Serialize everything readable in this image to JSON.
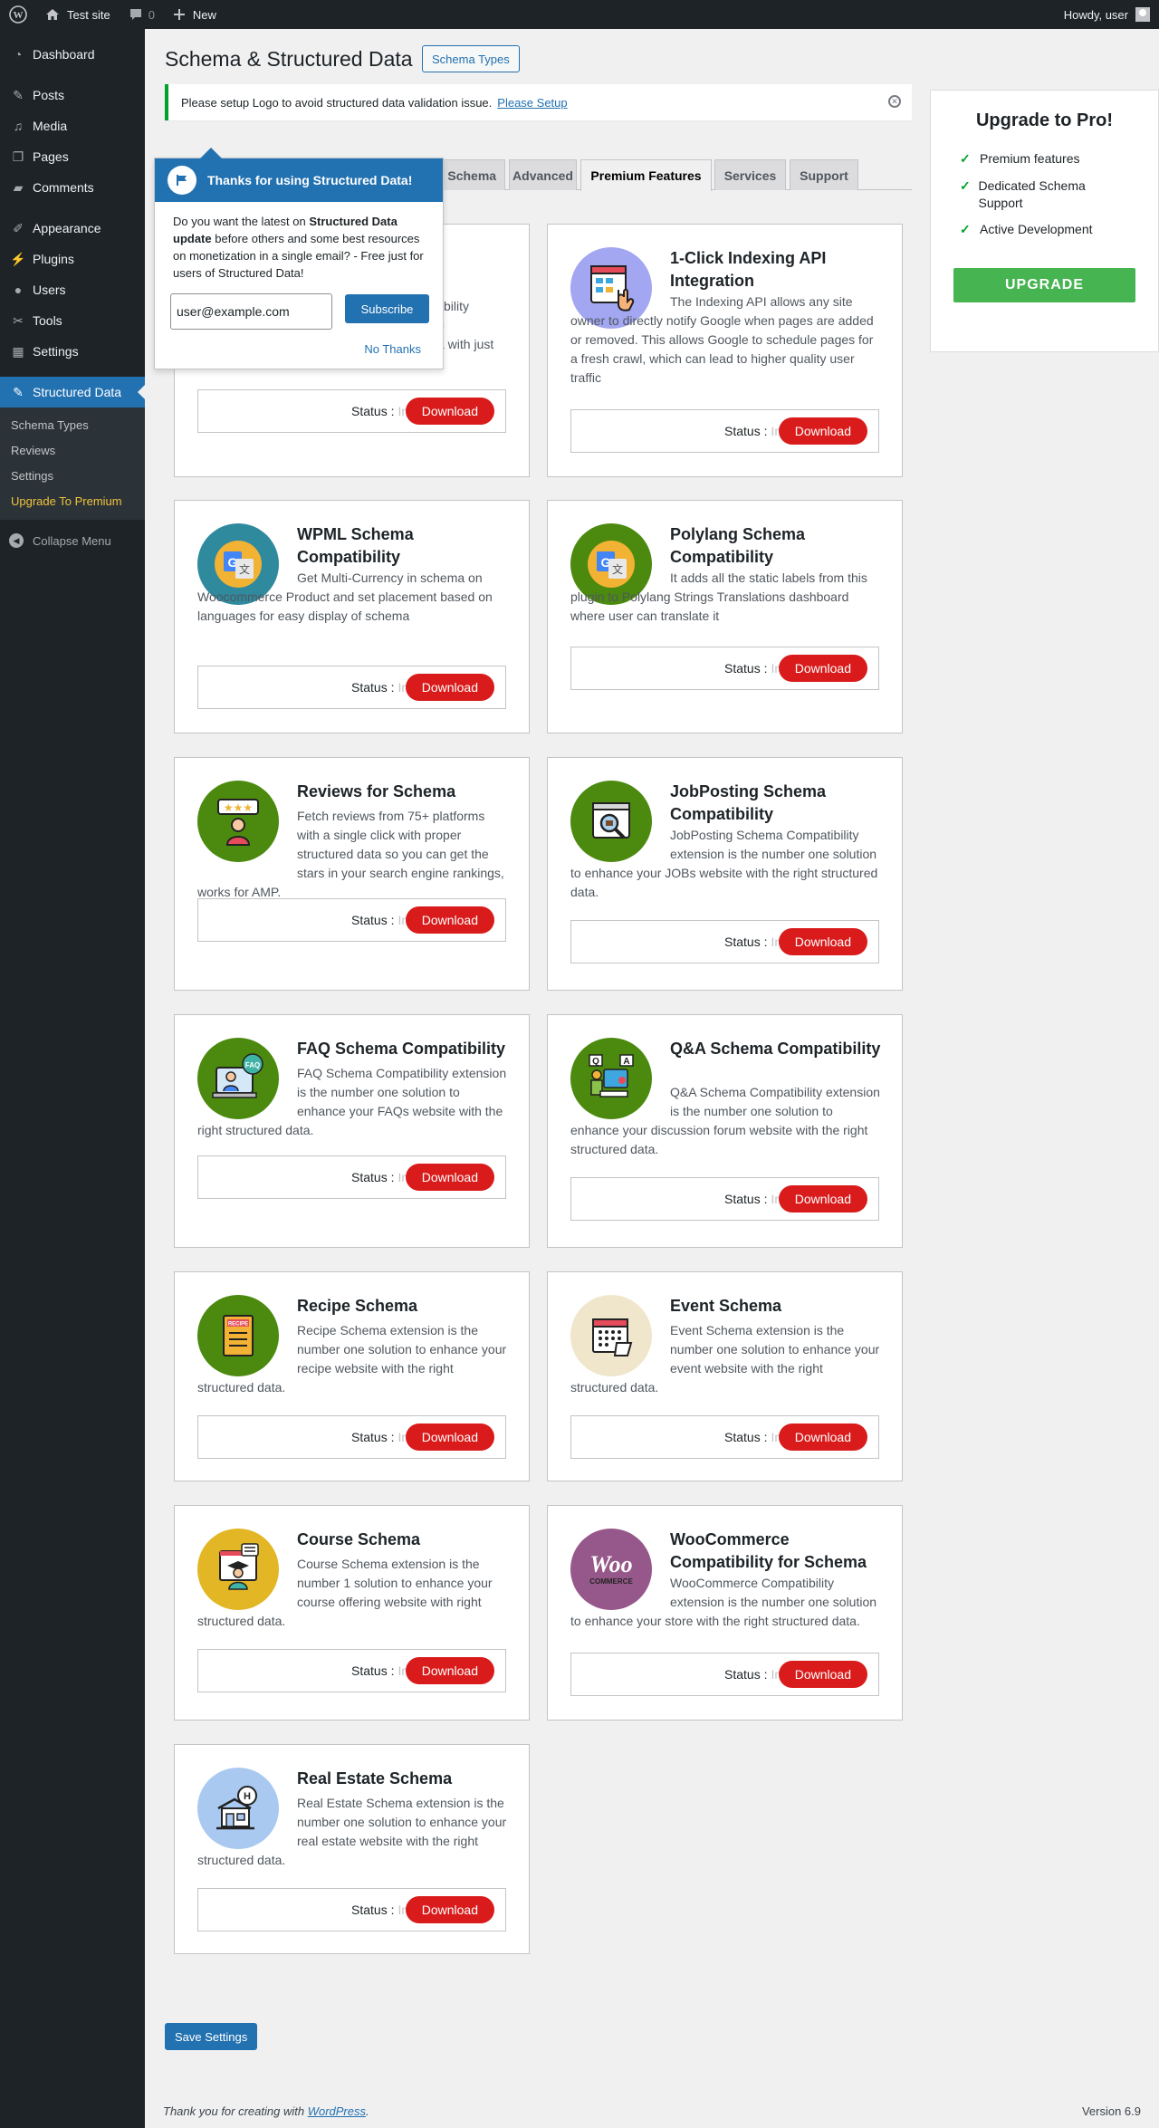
{
  "adminbar": {
    "site_name": "Test site",
    "comments_count": "0",
    "new_label": "New",
    "howdy": "Howdy, user"
  },
  "sidebar": {
    "items": [
      {
        "label": "Dashboard",
        "icon": "dashboard-icon"
      },
      {
        "label": "Posts",
        "icon": "pin-icon"
      },
      {
        "label": "Media",
        "icon": "media-icon"
      },
      {
        "label": "Pages",
        "icon": "pages-icon"
      },
      {
        "label": "Comments",
        "icon": "comment-icon"
      },
      {
        "label": "Appearance",
        "icon": "brush-icon"
      },
      {
        "label": "Plugins",
        "icon": "plug-icon"
      },
      {
        "label": "Users",
        "icon": "user-icon"
      },
      {
        "label": "Tools",
        "icon": "wrench-icon"
      },
      {
        "label": "Settings",
        "icon": "settings-icon"
      },
      {
        "label": "Structured Data",
        "icon": "pin-icon"
      }
    ],
    "submenu": [
      "Schema Types",
      "Reviews",
      "Settings",
      "Upgrade To Premium"
    ],
    "collapse": "Collapse Menu"
  },
  "header": {
    "title": "Schema & Structured Data",
    "button": "Schema Types"
  },
  "notice": {
    "text": "Please setup Logo to avoid structured data validation issue.",
    "link": "Please Setup"
  },
  "tabs": [
    "d Schema",
    "Advanced",
    "Premium Features",
    "Services",
    "Support"
  ],
  "popup": {
    "title": "Thanks for using Structured Data!",
    "body_pre": "Do you want the latest on ",
    "body_bold": "Structured Data update",
    "body_post": " before others and some best resources on monetization in a single email? - Free just for users of Structured Data!",
    "email": "user@example.com",
    "subscribe": "Subscribe",
    "no_thanks": "No Thanks"
  },
  "cards": [
    {
      "title": "",
      "desc": "Compatibility to",
      "partial": [
        "tibility",
        "o",
        "a with just"
      ]
    },
    {
      "title": "1-Click Indexing API Integration",
      "desc": "The Indexing API allows any site owner to directly notify Google when pages are added or removed. This allows Google to schedule pages for a fresh crawl, which can lead to higher quality user traffic"
    },
    {
      "title": "WPML Schema Compatibility",
      "desc": "Get Multi-Currency in schema on Woocommerce Product and set placement based on languages for easy display of schema"
    },
    {
      "title": "Polylang Schema Compatibility",
      "desc": "It adds all the static labels from this plugin to Polylang Strings Translations dashboard where user can translate it"
    },
    {
      "title": "Reviews for Schema",
      "desc": "Fetch reviews from 75+ platforms with a single click with proper structured data so you can get the stars in your search engine rankings, works for AMP."
    },
    {
      "title": "JobPosting Schema Compatibility",
      "desc": "JobPosting Schema Compatibility extension is the number one solution to enhance your JOBs website with the right structured data."
    },
    {
      "title": "FAQ Schema Compatibility",
      "desc": "FAQ Schema Compatibility extension is the number one solution to enhance your FAQs website with the right structured data."
    },
    {
      "title": "Q&A Schema Compatibility",
      "desc": "Q&A Schema Compatibility extension is the number one solution to enhance your discussion forum website with the right structured data."
    },
    {
      "title": "Recipe Schema",
      "desc": "Recipe Schema extension is the number one solution to enhance your recipe website with the right structured data."
    },
    {
      "title": "Event Schema",
      "desc": "Event Schema extension is the number one solution to enhance your event website with the right structured data."
    },
    {
      "title": "Course Schema",
      "desc": "Course Schema extension is the number 1 solution to enhance your course offering website with right structured data."
    },
    {
      "title": "WooCommerce Compatibility for Schema",
      "desc": "WooCommerce Compatibility extension is the number one solution to enhance your store with the right structured data."
    },
    {
      "title": "Real Estate Schema",
      "desc": "Real Estate Schema extension is the number one solution to enhance your real estate website with the right structured data."
    }
  ],
  "status_label": "Status :",
  "status_value": "Inactive",
  "download_label": "Download",
  "upgrade": {
    "title": "Upgrade to Pro!",
    "features": [
      "Premium features",
      "Dedicated Schema Support",
      "Active Development"
    ],
    "button": "UPGRADE"
  },
  "save_button": "Save Settings",
  "footer": {
    "thanks": "Thank you for creating with ",
    "link": "WordPress",
    "version": "Version 6.9"
  },
  "woo_logo": "Woo",
  "woo_sub": "COMMERCE",
  "faq_badge": "FAQ",
  "recipe_badge": "RECIPE",
  "colors": {
    "accent": "#2271b1",
    "download": "#d91b1b",
    "upgrade": "#46b450"
  }
}
